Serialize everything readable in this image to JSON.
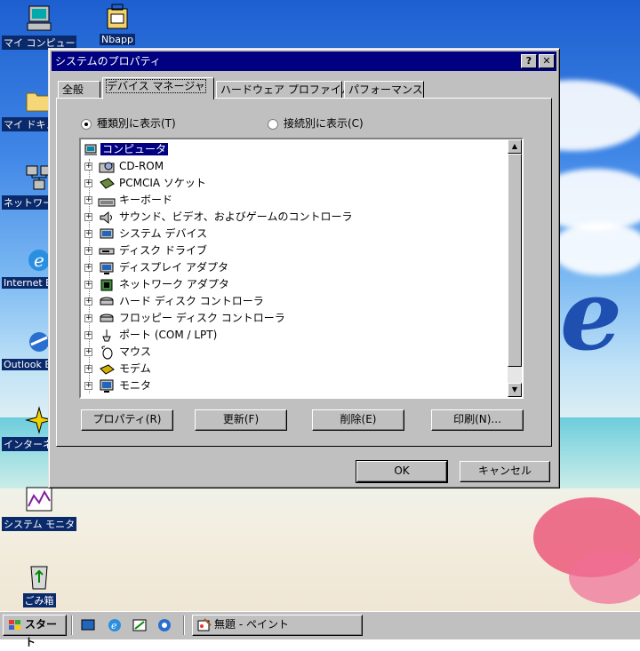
{
  "desktop": {
    "icons": [
      {
        "label": "マイ コンピュータ",
        "icon": "computer-icon"
      },
      {
        "label": "Nbapp",
        "icon": "briefcase-icon"
      },
      {
        "label": "マイ ドキュメント",
        "icon": "folder-icon"
      },
      {
        "label": "ネットワーク コンピュータ",
        "icon": "network-icon"
      },
      {
        "label": "Internet Explorer",
        "icon": "ie-icon"
      },
      {
        "label": "Outlook Express",
        "icon": "outlook-icon"
      },
      {
        "label": "インターネット接続",
        "icon": "connection-icon"
      },
      {
        "label": "システム モニタ",
        "icon": "monitor-chart-icon"
      },
      {
        "label": "ごみ箱",
        "icon": "recycle-bin-icon"
      }
    ],
    "wallpaper_letter": "e"
  },
  "dialog": {
    "title": "システムのプロパティ",
    "help_button": "?",
    "close_button": "✕",
    "tabs": [
      "全般",
      "デバイス マネージャ",
      "ハードウェア プロファイル",
      "パフォーマンス"
    ],
    "active_tab": 1,
    "view_options": {
      "by_type": "種類別に表示(T)",
      "by_connection": "接続別に表示(C)",
      "selected": "by_type"
    },
    "tree": {
      "root": "コンピュータ",
      "items": [
        {
          "label": "CD-ROM",
          "icon": "cdrom-icon"
        },
        {
          "label": "PCMCIA ソケット",
          "icon": "pcmcia-icon"
        },
        {
          "label": "キーボード",
          "icon": "keyboard-icon"
        },
        {
          "label": "サウンド、ビデオ、およびゲームのコントローラ",
          "icon": "sound-icon"
        },
        {
          "label": "システム デバイス",
          "icon": "system-device-icon"
        },
        {
          "label": "ディスク ドライブ",
          "icon": "disk-drive-icon"
        },
        {
          "label": "ディスプレイ アダプタ",
          "icon": "display-adapter-icon"
        },
        {
          "label": "ネットワーク アダプタ",
          "icon": "network-adapter-icon"
        },
        {
          "label": "ハード ディスク コントローラ",
          "icon": "hdd-controller-icon"
        },
        {
          "label": "フロッピー ディスク コントローラ",
          "icon": "fdd-controller-icon"
        },
        {
          "label": "ポート (COM / LPT)",
          "icon": "port-icon"
        },
        {
          "label": "マウス",
          "icon": "mouse-icon"
        },
        {
          "label": "モデム",
          "icon": "modem-icon"
        },
        {
          "label": "モニタ",
          "icon": "monitor-icon"
        }
      ]
    },
    "actions": {
      "properties": "プロパティ(R)",
      "refresh": "更新(F)",
      "remove": "削除(E)",
      "print": "印刷(N)..."
    },
    "ok": "OK",
    "cancel": "キャンセル"
  },
  "taskbar": {
    "start": "スタート",
    "task": "無題 - ペイント"
  },
  "colors": {
    "titlebar": "#000080",
    "face": "#c0c0c0",
    "selection": "#000080"
  }
}
